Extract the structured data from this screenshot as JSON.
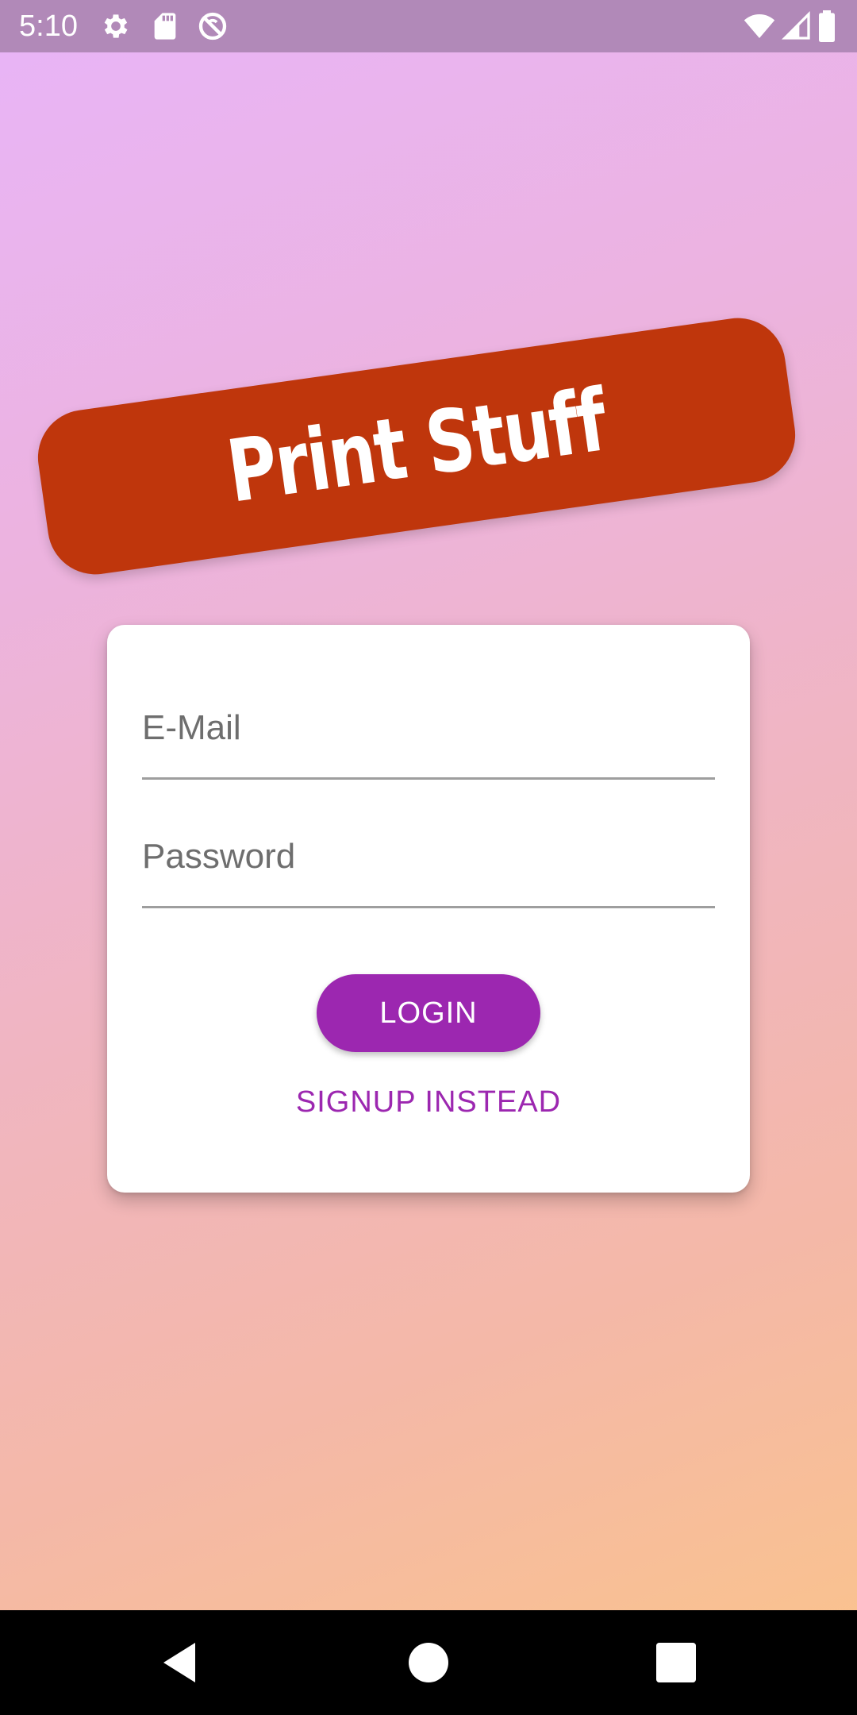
{
  "status_bar": {
    "time": "5:10",
    "left_icons": [
      "gear-icon",
      "sd-card-icon",
      "sync-disabled-icon"
    ],
    "right_icons": [
      "wifi-icon",
      "cell-signal-icon",
      "battery-icon"
    ]
  },
  "banner": {
    "title": "Print Stuff",
    "color": "#bf360c"
  },
  "form": {
    "email_placeholder": "E-Mail",
    "password_placeholder": "Password",
    "login_label": "LOGIN",
    "signup_label": "SIGNUP INSTEAD",
    "accent_color": "#9c27b0"
  },
  "nav_bar": {
    "buttons": [
      "back-icon",
      "home-icon",
      "recents-icon"
    ]
  }
}
